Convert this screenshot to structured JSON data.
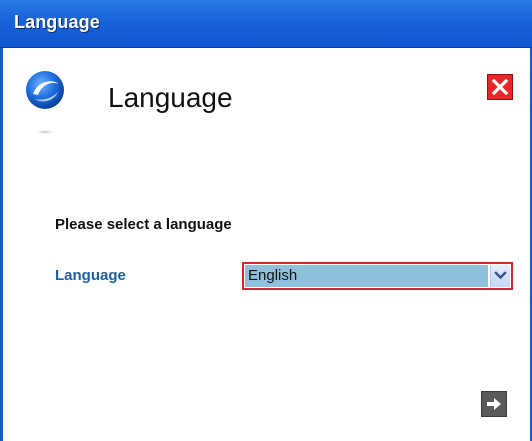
{
  "window": {
    "title": "Language"
  },
  "header": {
    "title": "Language",
    "logo_icon": "blue-swirl-logo-icon",
    "close_icon": "close-icon"
  },
  "form": {
    "prompt": "Please select a language",
    "language_label": "Language",
    "language_select": {
      "selected": "English"
    }
  },
  "footer": {
    "next_icon": "arrow-right-icon"
  },
  "colors": {
    "titlebar": "#1862d9",
    "label_blue": "#1a5fa8",
    "close_red": "#e8262a",
    "select_highlight": "#8fc0db",
    "select_border": "#d8252a"
  }
}
